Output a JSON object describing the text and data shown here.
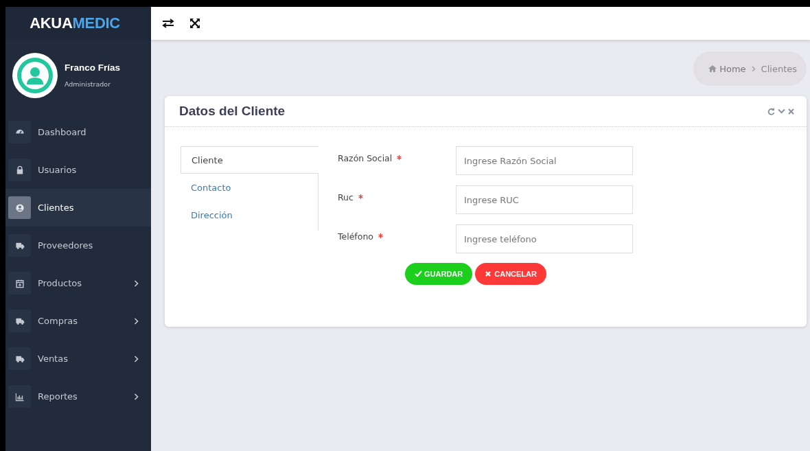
{
  "brand": {
    "parts": [
      {
        "text": "AKUA",
        "kind": "plain"
      },
      {
        "text": "MEDIC",
        "kind": "accent"
      }
    ]
  },
  "user": {
    "name": "Franco Frías",
    "role": "Administrador"
  },
  "nav": [
    {
      "label": "Dashboard",
      "selected": false,
      "expandable": false
    },
    {
      "label": "Usuarios",
      "selected": false,
      "expandable": false
    },
    {
      "label": "Clientes",
      "selected": true,
      "expandable": false
    },
    {
      "label": "Proveedores",
      "selected": false,
      "expandable": false
    },
    {
      "label": "Productos",
      "selected": false,
      "expandable": true
    },
    {
      "label": "Compras",
      "selected": false,
      "expandable": true
    },
    {
      "label": "Ventas",
      "selected": false,
      "expandable": true
    },
    {
      "label": "Reportes",
      "selected": false,
      "expandable": true
    }
  ],
  "breadcrumb": [
    {
      "label": "Home"
    },
    {
      "label": "Clientes"
    }
  ],
  "card": {
    "title": "Datos del Cliente",
    "tabs": [
      {
        "label": "Cliente",
        "selected": true
      },
      {
        "label": "Contacto",
        "selected": false
      },
      {
        "label": "Dirección",
        "selected": false
      }
    ],
    "fields": [
      {
        "label": "Razón Social",
        "required": true,
        "placeholder": "Ingrese Razón Social"
      },
      {
        "label": "Ruc",
        "required": true,
        "placeholder": "Ingrese RUC"
      },
      {
        "label": "Teléfono",
        "required": true,
        "placeholder": "Ingrese teléfono"
      }
    ],
    "buttons": [
      {
        "label": "GUARDAR",
        "kind": "save"
      },
      {
        "label": "CANCELAR",
        "kind": "cancel"
      }
    ]
  }
}
